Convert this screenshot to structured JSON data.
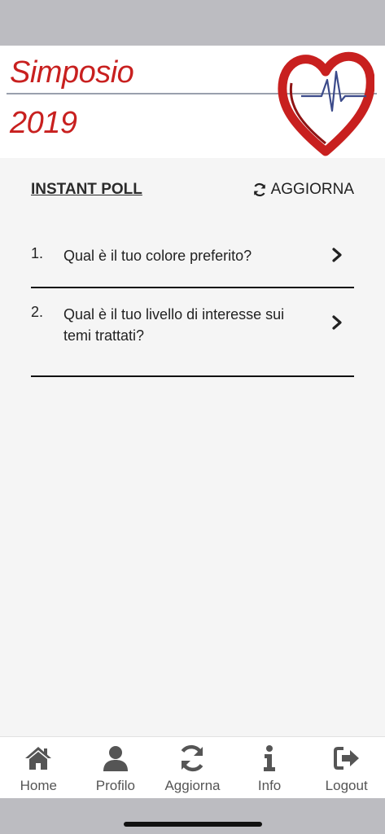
{
  "header": {
    "brand_line1": "Simposio",
    "brand_line2": "2019",
    "logo_icon": "heart-ecg-logo"
  },
  "poll": {
    "title": "INSTANT POLL",
    "refresh_label": "AGGIORNA",
    "items": [
      {
        "number": "1.",
        "question": "Qual è il tuo colore preferito?"
      },
      {
        "number": "2.",
        "question": "Qual è il tuo livello di interesse sui temi trattati?"
      }
    ]
  },
  "tabbar": {
    "items": [
      {
        "label": "Home",
        "icon": "home-icon"
      },
      {
        "label": "Profilo",
        "icon": "user-icon"
      },
      {
        "label": "Aggiorna",
        "icon": "refresh-icon"
      },
      {
        "label": "Info",
        "icon": "info-icon"
      },
      {
        "label": "Logout",
        "icon": "logout-icon"
      }
    ]
  },
  "colors": {
    "brand_red": "#c8201f",
    "text_dark": "#222222",
    "icon_gray": "#555555",
    "background": "#f5f5f5"
  }
}
